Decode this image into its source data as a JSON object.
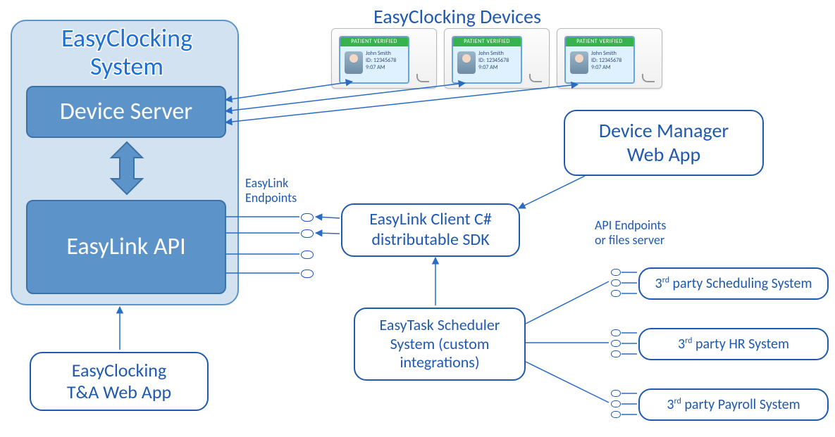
{
  "title_devices": "EasyClocking Devices",
  "system_title_l1": "EasyClocking",
  "system_title_l2": "System",
  "device_server": "Device Server",
  "easylink_api": "EasyLink API",
  "endpoints_label_l1": "EasyLink",
  "endpoints_label_l2": "Endpoints",
  "sdk_l1": "EasyLink Client C#",
  "sdk_l2": "distributable SDK",
  "devmgr_l1": "Device Manager",
  "devmgr_l2": "Web App",
  "scheduler_l1": "EasyTask Scheduler",
  "scheduler_l2": "System (custom",
  "scheduler_l3": "integrations)",
  "api_endpoints_l1": "API Endpoints",
  "api_endpoints_l2": "or files server",
  "tp_scheduling": "3rd party Scheduling System",
  "tp_hr": "3rd party HR System",
  "tp_payroll": "3rd party Payroll System",
  "ta_l1": "EasyClocking",
  "ta_l2": "T&A Web App",
  "dev_bar": "PATIENT VERIFIED",
  "dev_name": "John Smith",
  "dev_id": "ID: 12345678",
  "dev_time": "9:07 AM"
}
